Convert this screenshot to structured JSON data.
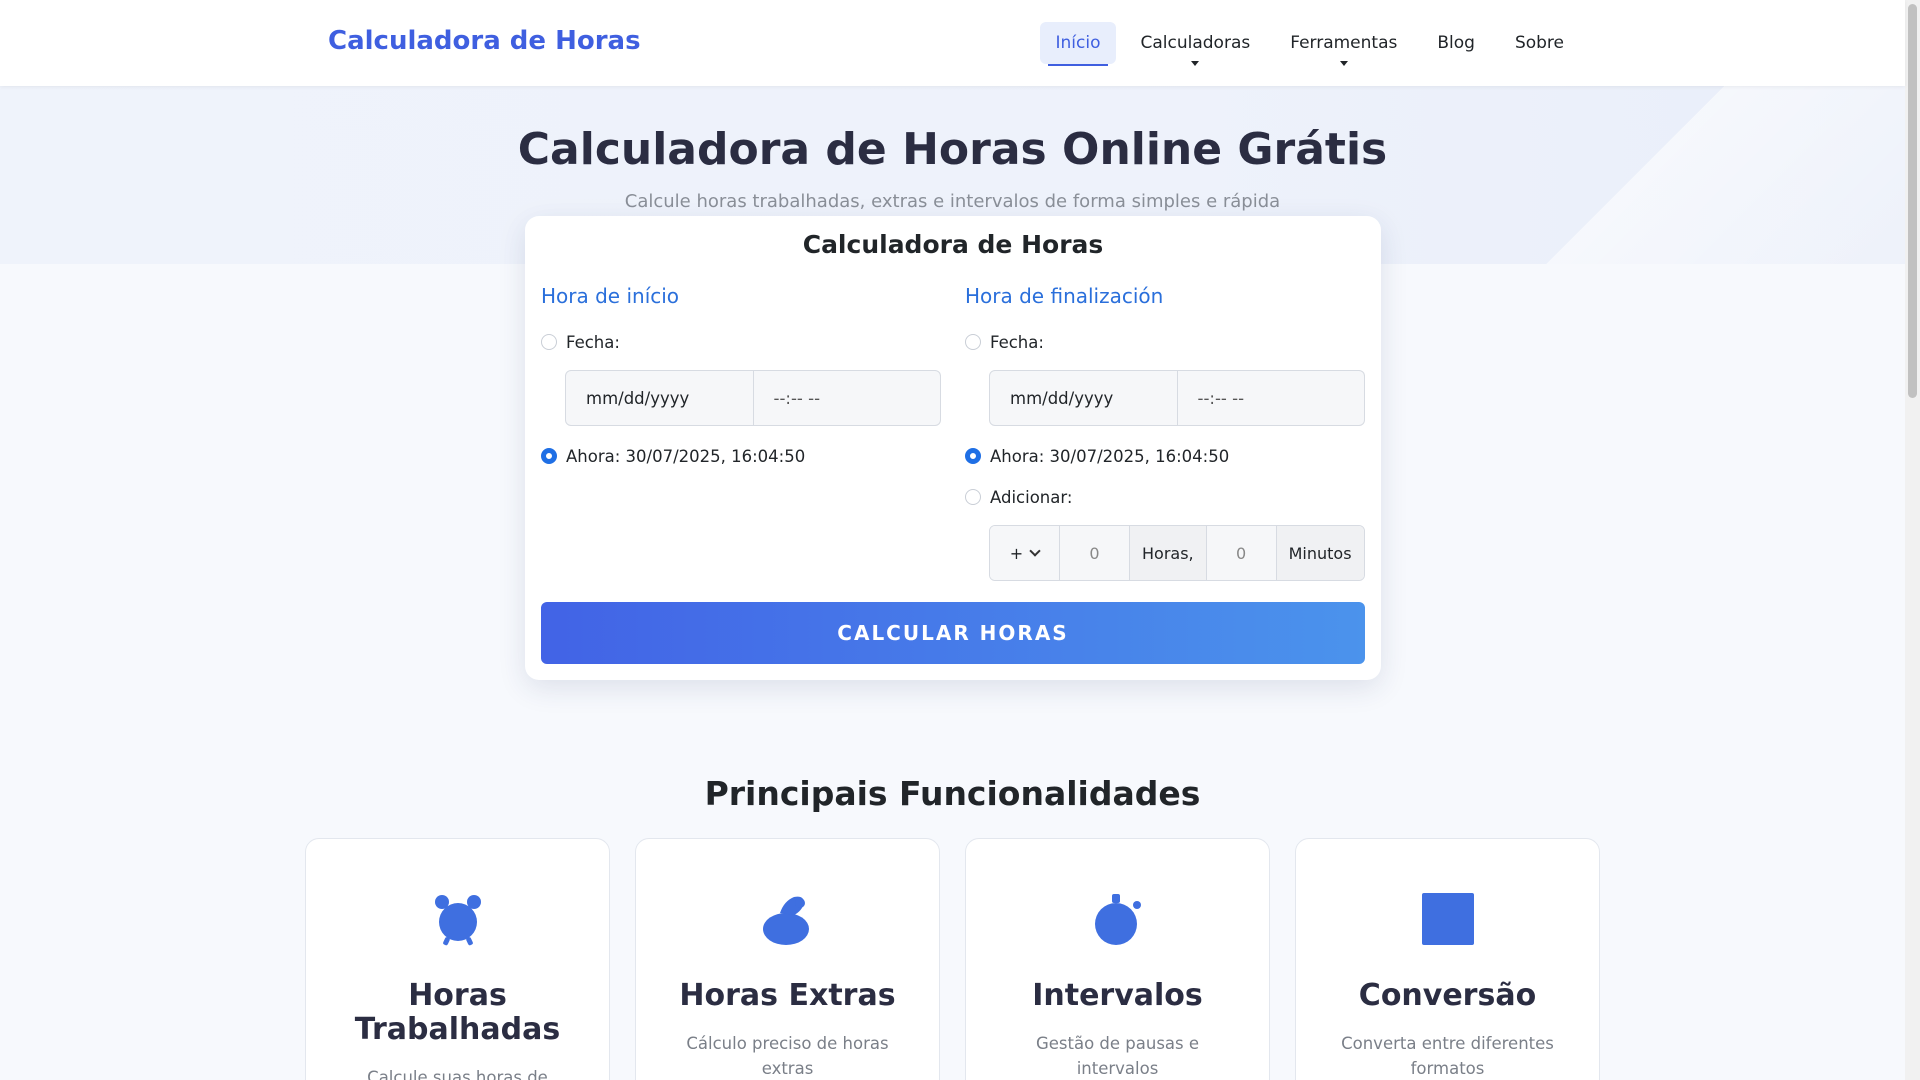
{
  "brand": {
    "icon": "clock-icon",
    "glyph": "",
    "name": "Calculadora de Horas"
  },
  "nav": [
    {
      "label": "Início",
      "active": true
    },
    {
      "label": "Calculadoras",
      "dropdown": true
    },
    {
      "label": "Ferramentas",
      "dropdown": true
    },
    {
      "label": "Blog"
    },
    {
      "label": "Sobre"
    }
  ],
  "hero": {
    "title": "Calculadora de Horas Online Grátis",
    "subtitle": "Calcule horas trabalhadas, extras e intervalos de forma simples e rápida"
  },
  "calculator": {
    "title": "Calculadora de Horas",
    "start": {
      "heading": "Hora de início",
      "date_label": "Fecha:",
      "date_placeholder": "mm/dd/yyyy",
      "time_placeholder": "--:-- --",
      "now_label": "Ahora: 30/07/2025, 16:04:50"
    },
    "end": {
      "heading": "Hora de finalización",
      "date_label": "Fecha:",
      "date_placeholder": "mm/dd/yyyy",
      "time_placeholder": "--:-- --",
      "now_label": "Ahora: 30/07/2025, 16:04:50",
      "add_label": "Adicionar:",
      "operator": "+",
      "hours_value": "0",
      "hours_label": "Horas,",
      "minutes_value": "0",
      "minutes_label": "Minutos"
    },
    "button": "CALCULAR HORAS"
  },
  "features": {
    "title": "Principais Funcionalidades",
    "items": [
      {
        "icon": "alarm-clock-icon",
        "title": "Horas Trabalhadas",
        "desc": "Calcule suas horas de trabalho"
      },
      {
        "icon": "money-bag-icon",
        "title": "Horas Extras",
        "desc": "Cálculo preciso de horas extras"
      },
      {
        "icon": "stopwatch-icon",
        "title": "Intervalos",
        "desc": "Gestão de pausas e intervalos"
      },
      {
        "icon": "conversion-icon",
        "title": "Conversão",
        "desc": "Converta entre diferentes formatos"
      }
    ]
  },
  "colors": {
    "brand": "#3f5fe0",
    "accent": "#1f6fe5",
    "heading": "#2b2d42",
    "icon": "#3f6fe0"
  }
}
